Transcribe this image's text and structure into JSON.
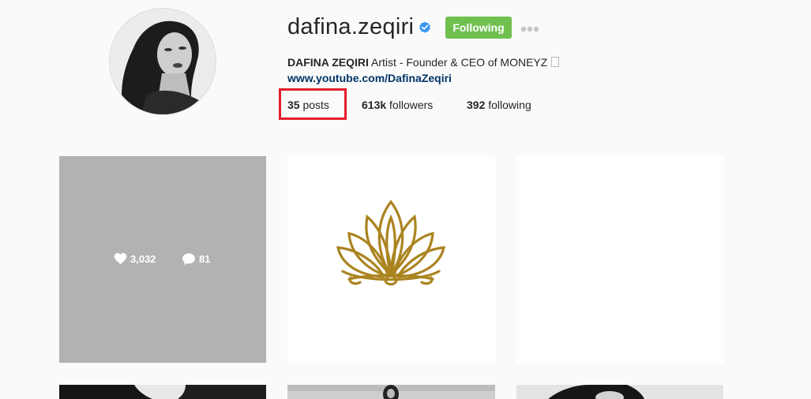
{
  "profile": {
    "username": "dafina.zeqiri",
    "follow_label": "Following",
    "full_name": "DAFINA ZEQIRI",
    "bio": "Artist - Founder & CEO of MONEYZ",
    "website": "www.youtube.com/DafinaZeqiri",
    "accent_color": "#70c050",
    "verified_color": "#3897f0"
  },
  "stats": {
    "posts": {
      "count": "35",
      "label": "posts"
    },
    "followers": {
      "count": "613k",
      "label": "followers"
    },
    "following": {
      "count": "392",
      "label": "following"
    }
  },
  "grid": {
    "hovered_post": {
      "likes": "3,032",
      "comments": "81"
    }
  }
}
